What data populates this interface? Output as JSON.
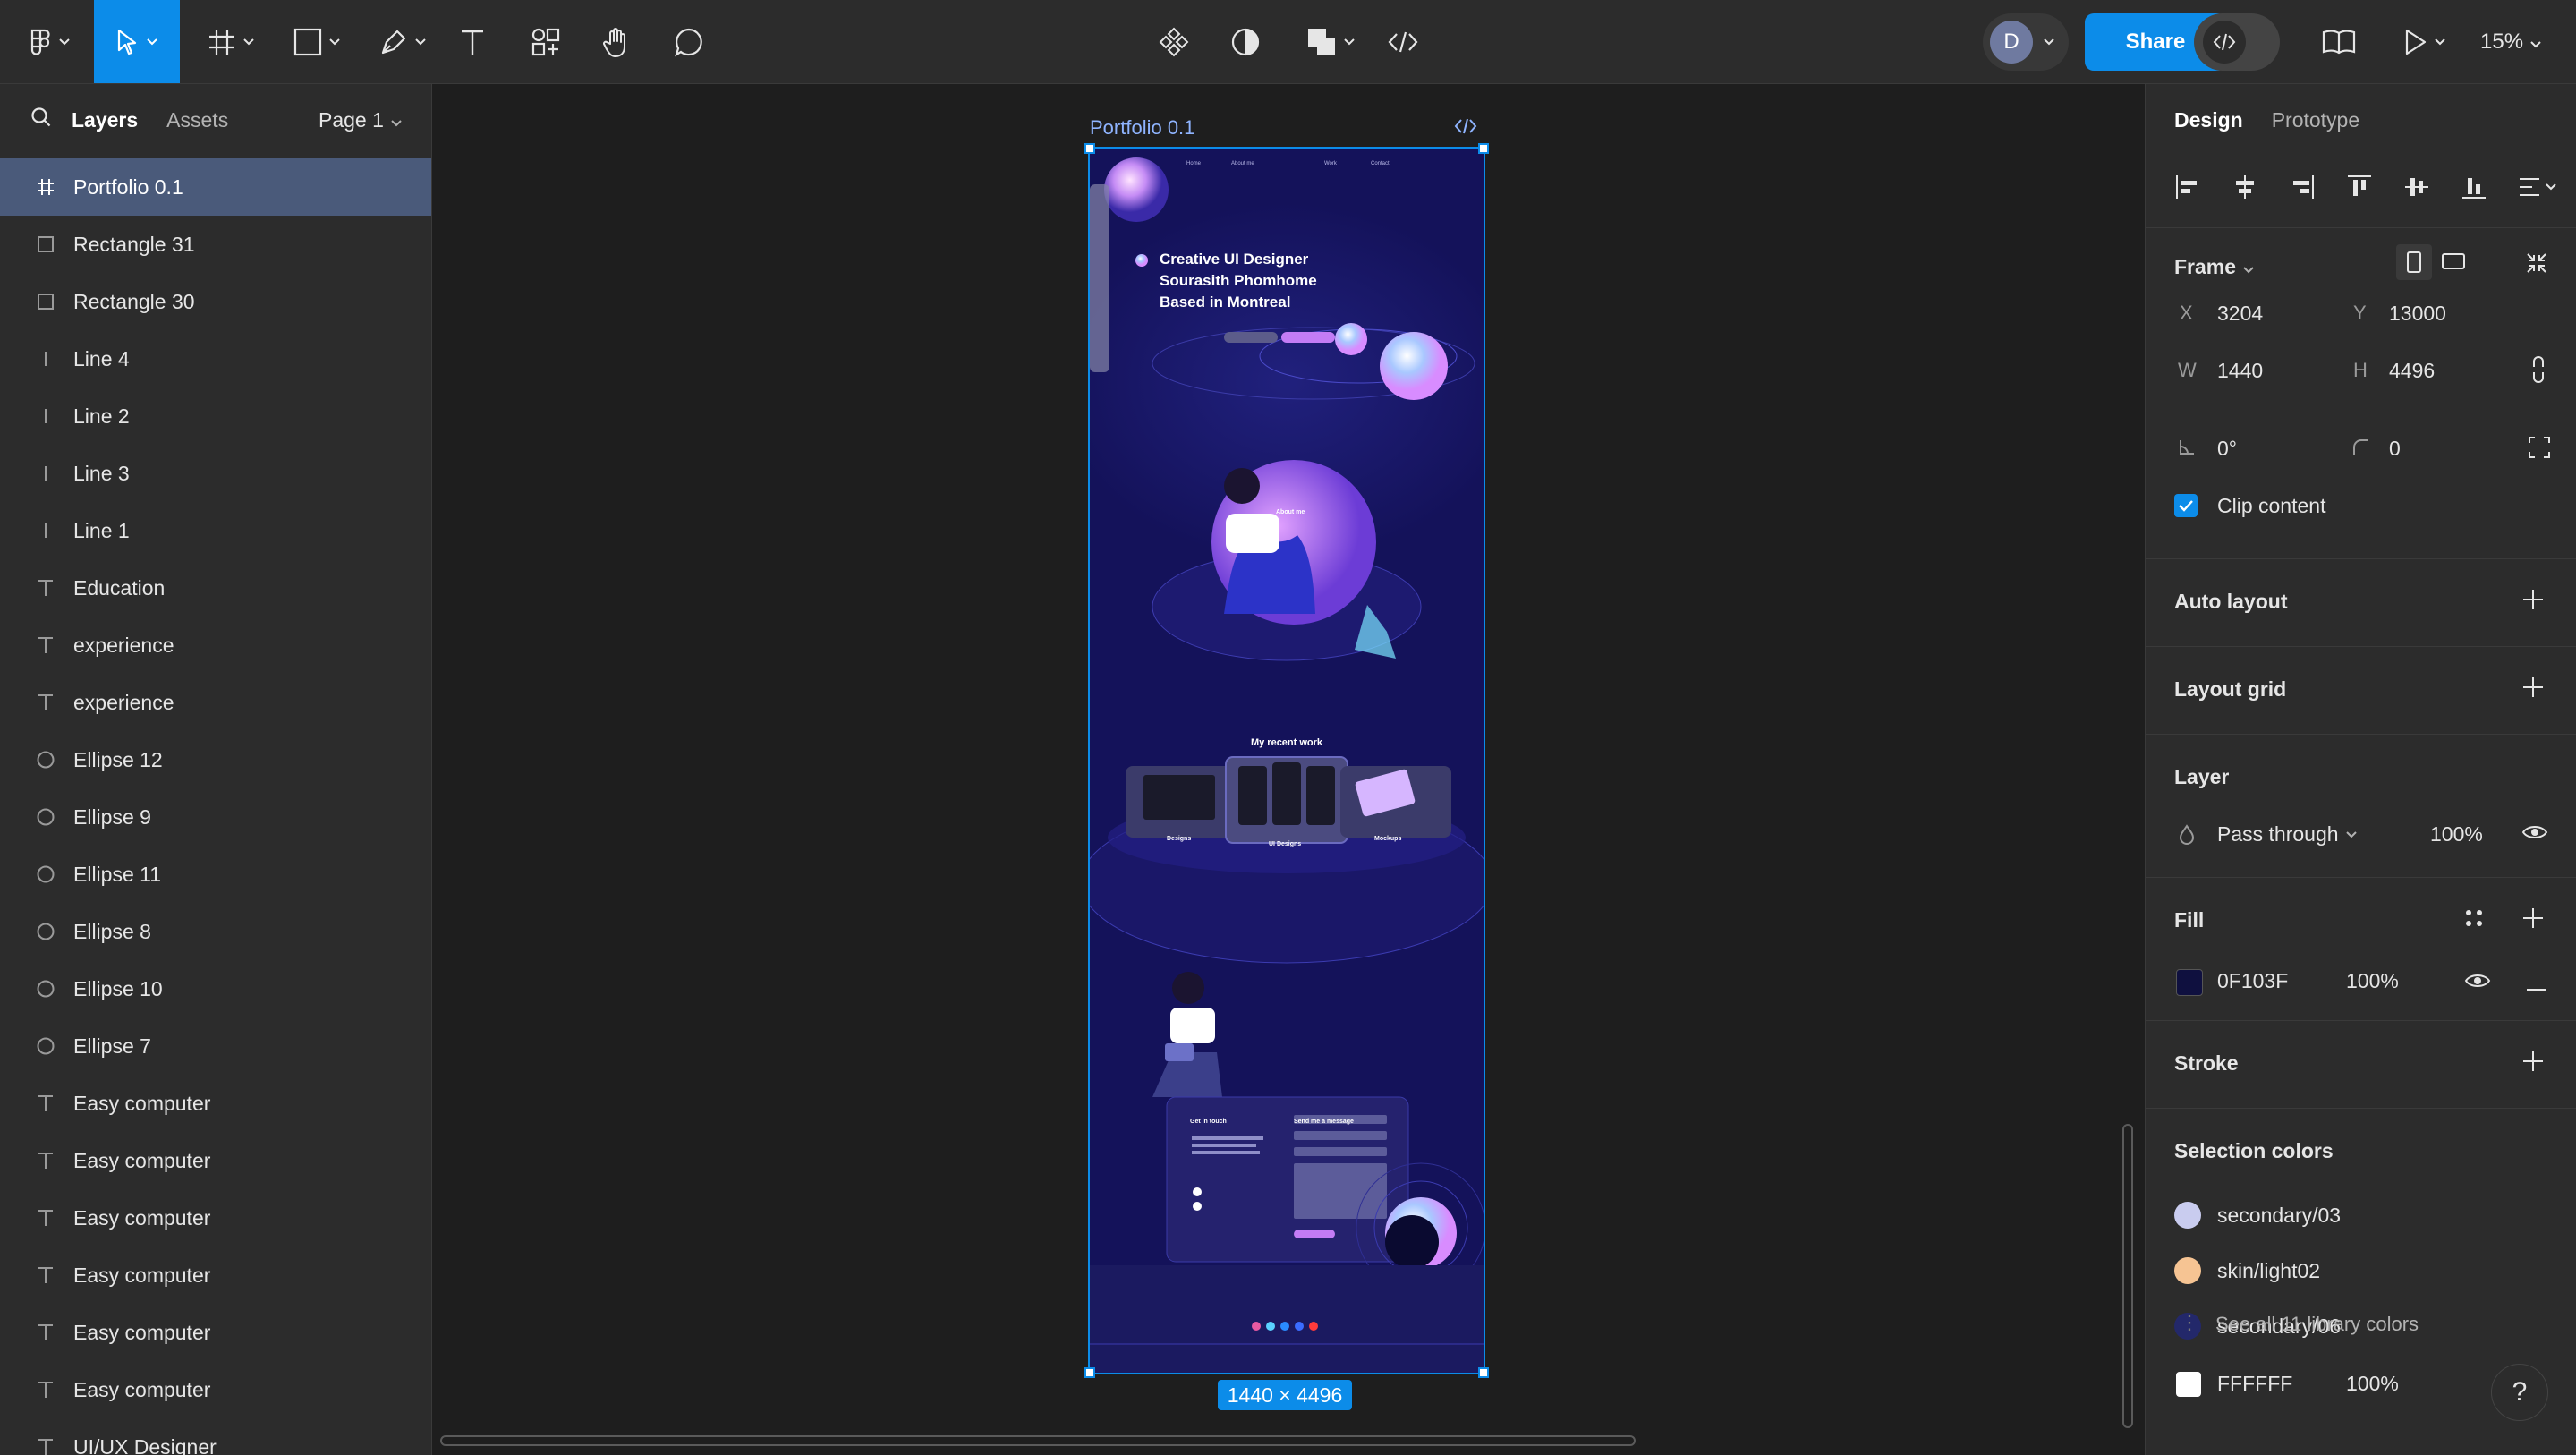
{
  "toolbar": {
    "zoom": "15%",
    "share_label": "Share",
    "avatar_initial": "D"
  },
  "left_panel": {
    "tabs": {
      "layers": "Layers",
      "assets": "Assets"
    },
    "page": "Page 1",
    "layers": [
      {
        "name": "Portfolio 0.1",
        "icon": "frame-icon",
        "selected": true
      },
      {
        "name": "Rectangle 31",
        "icon": "rectangle-icon"
      },
      {
        "name": "Rectangle 30",
        "icon": "rectangle-icon"
      },
      {
        "name": "Line 4",
        "icon": "line-icon"
      },
      {
        "name": "Line 2",
        "icon": "line-icon"
      },
      {
        "name": "Line 3",
        "icon": "line-icon"
      },
      {
        "name": "Line 1",
        "icon": "line-icon"
      },
      {
        "name": "Education",
        "icon": "text-icon"
      },
      {
        "name": "experience",
        "icon": "text-icon"
      },
      {
        "name": "experience",
        "icon": "text-icon"
      },
      {
        "name": "Ellipse 12",
        "icon": "ellipse-icon"
      },
      {
        "name": "Ellipse 9",
        "icon": "ellipse-icon"
      },
      {
        "name": "Ellipse 11",
        "icon": "ellipse-icon"
      },
      {
        "name": "Ellipse 8",
        "icon": "ellipse-icon"
      },
      {
        "name": "Ellipse 10",
        "icon": "ellipse-icon"
      },
      {
        "name": "Ellipse 7",
        "icon": "ellipse-icon"
      },
      {
        "name": "Easy computer",
        "icon": "text-icon"
      },
      {
        "name": "Easy computer",
        "icon": "text-icon"
      },
      {
        "name": "Easy computer",
        "icon": "text-icon"
      },
      {
        "name": "Easy computer",
        "icon": "text-icon"
      },
      {
        "name": "Easy computer",
        "icon": "text-icon"
      },
      {
        "name": "Easy computer",
        "icon": "text-icon"
      },
      {
        "name": "UI/UX Designer",
        "icon": "text-icon"
      }
    ]
  },
  "canvas": {
    "frame_title": "Portfolio 0.1",
    "frame_size": "1440 × 4496",
    "design": {
      "nav": [
        "Home",
        "About me",
        "Work",
        "Contact"
      ],
      "hero": "Creative UI Designer Sourasith Phomhome Based in Montreal",
      "about_title": "About me",
      "work_title": "My recent work",
      "work_cards": [
        "Designs",
        "UI Designs",
        "Mockups"
      ],
      "contact_left": "Get in touch",
      "contact_right": "Send me a message"
    }
  },
  "right_panel": {
    "tabs": {
      "design": "Design",
      "prototype": "Prototype"
    },
    "frame": {
      "title": "Frame",
      "x_label": "X",
      "x": "3204",
      "y_label": "Y",
      "y": "13000",
      "w_label": "W",
      "w": "1440",
      "h_label": "H",
      "h": "4496",
      "rotation": "0°",
      "radius": "0",
      "clip_label": "Clip content"
    },
    "auto_layout": "Auto layout",
    "layout_grid": "Layout grid",
    "layer": {
      "title": "Layer",
      "blend": "Pass through",
      "opacity": "100%"
    },
    "fill": {
      "title": "Fill",
      "hex": "0F103F",
      "opacity": "100%",
      "color": "#0F103F"
    },
    "stroke": "Stroke",
    "selection_colors": {
      "title": "Selection colors",
      "items": [
        {
          "name": "secondary/03",
          "color": "#C9CCEF"
        },
        {
          "name": "skin/light02",
          "color": "#F6C493"
        },
        {
          "name": "secondary/06",
          "color": "#23286A"
        }
      ],
      "see_all": "See all 11 library colors",
      "last_hex": "FFFFFF",
      "last_opacity": "100%",
      "last_color": "#FFFFFF"
    }
  }
}
